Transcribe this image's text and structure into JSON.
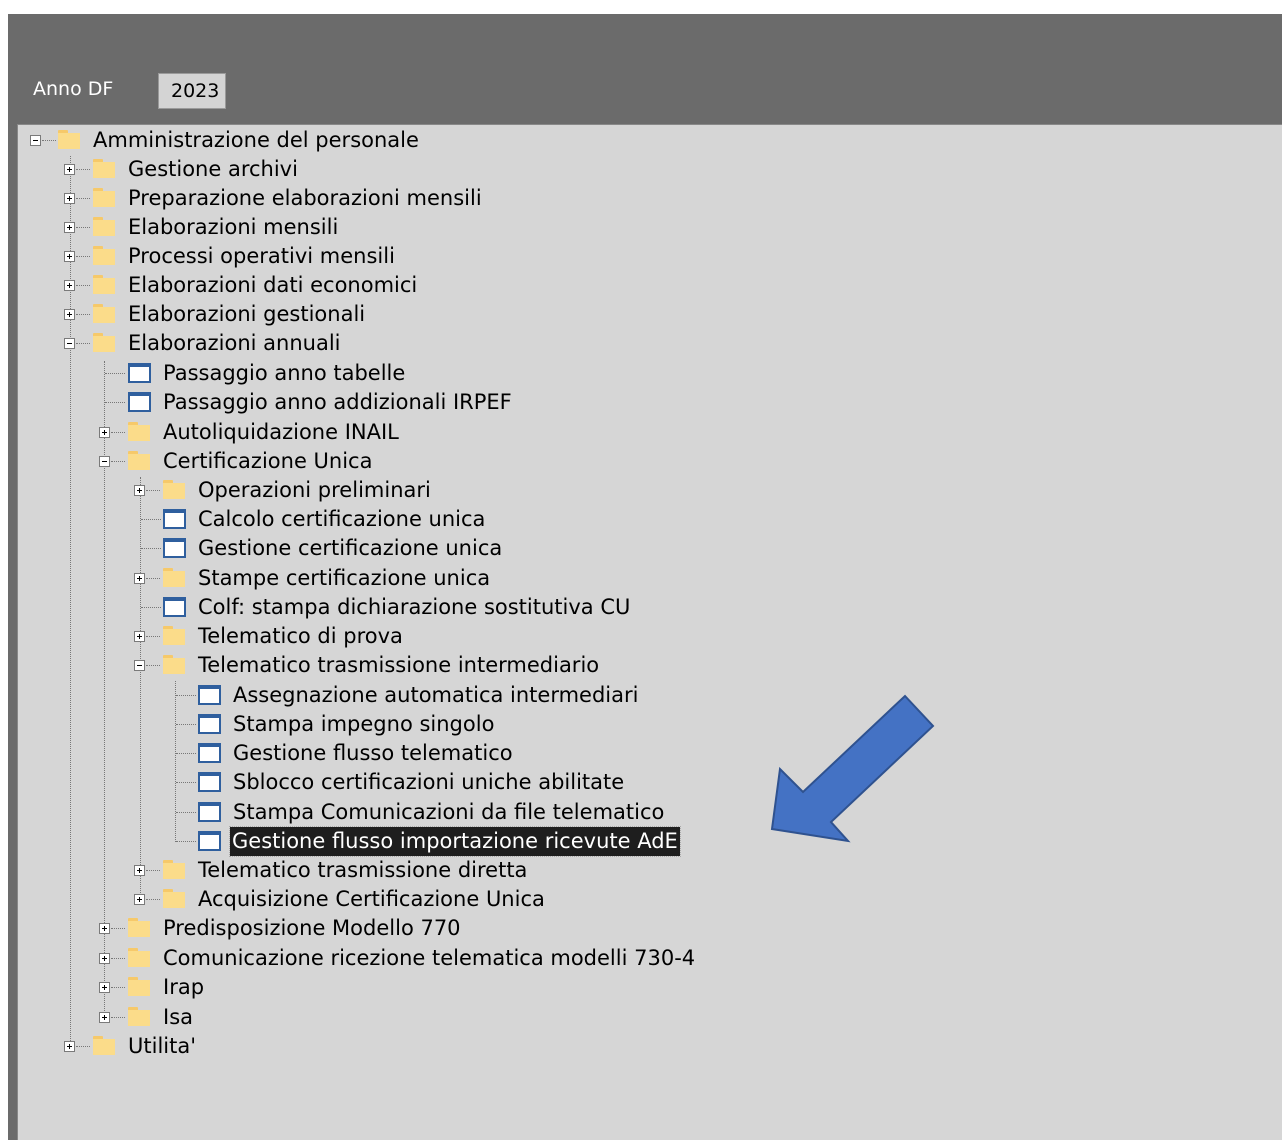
{
  "header": {
    "anno_label": "Anno DF",
    "anno_value": "2023"
  },
  "tree": {
    "root": "Amministrazione del personale",
    "level1": [
      "Gestione archivi",
      "Preparazione elaborazioni mensili",
      "Elaborazioni mensili",
      "Processi operativi mensili",
      "Elaborazioni dati economici",
      "Elaborazioni gestionali",
      "Elaborazioni annuali"
    ],
    "annuali": [
      "Passaggio anno tabelle",
      "Passaggio anno addizionali IRPEF",
      "Autoliquidazione INAIL",
      "Certificazione Unica"
    ],
    "cu": [
      "Operazioni preliminari",
      "Calcolo certificazione unica",
      "Gestione certificazione unica",
      "Stampe certificazione unica",
      "Colf: stampa dichiarazione sostitutiva CU",
      "Telematico di prova",
      "Telematico trasmissione intermediario"
    ],
    "intermediario": [
      "Assegnazione automatica intermediari",
      "Stampa impegno singolo",
      "Gestione flusso telematico",
      "Sblocco certificazioni uniche abilitate",
      "Stampa Comunicazioni da file telematico",
      "Gestione flusso importazione ricevute AdE"
    ],
    "cu_tail": [
      "Telematico trasmissione diretta",
      "Acquisizione Certificazione Unica"
    ],
    "annuali_tail": [
      "Predisposizione Modello 770",
      "Comunicazione ricezione telematica modelli 730-4",
      "Irap",
      "Isa"
    ],
    "last": "Utilita'"
  },
  "colors": {
    "arrow": "#4472c4",
    "selection": "#1e1e1e",
    "panel": "#d6d6d6",
    "header": "#6b6b6b"
  }
}
